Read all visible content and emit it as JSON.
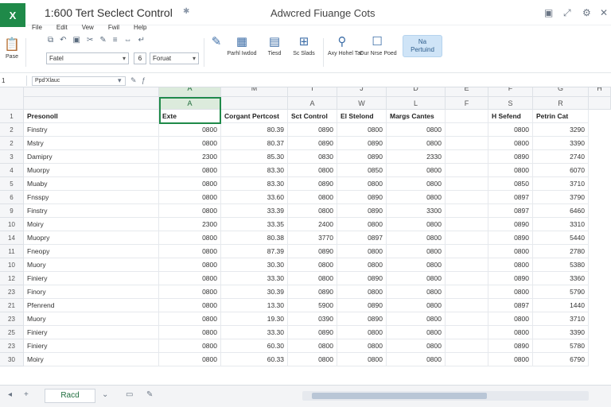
{
  "window": {
    "app_icon": "X",
    "doc_title": "1:600 Tert Seclect Control",
    "app_title": "Adwcred Fiuange Cots"
  },
  "menu": [
    "File",
    "Edit",
    "Vew",
    "Fwil",
    "Help"
  ],
  "ribbon": {
    "paste_label": "Pase",
    "font_value": "Fatel",
    "font_size": "6",
    "number_format": "Foruat",
    "buttons": [
      {
        "icon": "pen-icon",
        "label": ""
      },
      {
        "icon": "table-icon",
        "label": "Parhl Iwdod"
      },
      {
        "icon": "chart-icon",
        "label": "Tiesd"
      },
      {
        "icon": "grid-icon",
        "label": "Sc Slads"
      },
      {
        "icon": "filter-icon",
        "label": "Axy Hohel Tar"
      },
      {
        "icon": "box-icon",
        "label": "Our Nrse Poed"
      }
    ],
    "highlight_label_1": "Na",
    "highlight_label_2": "Pertuind"
  },
  "formula": {
    "name_box": "1",
    "content": "Ppd'Xlauc"
  },
  "columns": {
    "letters": [
      "A",
      "M",
      "T",
      "J",
      "D",
      "E",
      "F",
      "G",
      "H"
    ],
    "second_row": [
      "A",
      "",
      "A",
      "W",
      "L",
      "F",
      "S",
      "R",
      ""
    ]
  },
  "headers": [
    "Presonoll",
    "Exte",
    "Corgant Pertcost",
    "Sct Control",
    "El Stelond",
    "Margs Cantes",
    "",
    "H Sefend",
    "Petrin Cat"
  ],
  "rows": [
    {
      "n": "2",
      "name": "Finstry",
      "c": [
        "0800",
        "80.39",
        "0890",
        "0800",
        "0800",
        "",
        "0800",
        "3290"
      ]
    },
    {
      "n": "2",
      "name": "Mstry",
      "c": [
        "0800",
        "80.37",
        "0890",
        "0890",
        "0800",
        "",
        "0800",
        "3390"
      ]
    },
    {
      "n": "3",
      "name": "Damipry",
      "c": [
        "2300",
        "85.30",
        "0830",
        "0890",
        "2330",
        "",
        "0890",
        "2740"
      ]
    },
    {
      "n": "4",
      "name": "Muorpy",
      "c": [
        "0800",
        "83.30",
        "0800",
        "0850",
        "0800",
        "",
        "0800",
        "6070"
      ]
    },
    {
      "n": "5",
      "name": "Muaby",
      "c": [
        "0800",
        "83.30",
        "0890",
        "0800",
        "0800",
        "",
        "0850",
        "3710"
      ]
    },
    {
      "n": "6",
      "name": "Fnsspy",
      "c": [
        "0800",
        "33.60",
        "0800",
        "0890",
        "0800",
        "",
        "0897",
        "3790"
      ]
    },
    {
      "n": "9",
      "name": "Finstry",
      "c": [
        "0800",
        "33.39",
        "0800",
        "0890",
        "3300",
        "",
        "0897",
        "6460"
      ]
    },
    {
      "n": "10",
      "name": "Moiry",
      "c": [
        "2300",
        "33.35",
        "2400",
        "0800",
        "0800",
        "",
        "0890",
        "3310"
      ]
    },
    {
      "n": "14",
      "name": "Muopry",
      "c": [
        "0800",
        "80.38",
        "3770",
        "0897",
        "0800",
        "",
        "0890",
        "5440"
      ]
    },
    {
      "n": "11",
      "name": "Fneopy",
      "c": [
        "0800",
        "87.39",
        "0890",
        "0800",
        "0800",
        "",
        "0800",
        "2780"
      ]
    },
    {
      "n": "10",
      "name": "Muory",
      "c": [
        "0800",
        "30.30",
        "0800",
        "0800",
        "0800",
        "",
        "0800",
        "5380"
      ]
    },
    {
      "n": "12",
      "name": "Finiery",
      "c": [
        "0800",
        "33.30",
        "0800",
        "0890",
        "0800",
        "",
        "0890",
        "3360"
      ]
    },
    {
      "n": "23",
      "name": "Finory",
      "c": [
        "0800",
        "30.39",
        "0890",
        "0800",
        "0800",
        "",
        "0800",
        "5790"
      ]
    },
    {
      "n": "21",
      "name": "Pfenrend",
      "c": [
        "0800",
        "13.30",
        "5900",
        "0890",
        "0800",
        "",
        "0897",
        "1440"
      ]
    },
    {
      "n": "23",
      "name": "Muory",
      "c": [
        "0800",
        "19.30",
        "0390",
        "0890",
        "0800",
        "",
        "0800",
        "3710"
      ]
    },
    {
      "n": "25",
      "name": "Finiery",
      "c": [
        "0800",
        "33.30",
        "0890",
        "0800",
        "0800",
        "",
        "0800",
        "3390"
      ]
    },
    {
      "n": "23",
      "name": "Finiery",
      "c": [
        "0800",
        "60.30",
        "0800",
        "0800",
        "0800",
        "",
        "0890",
        "5780"
      ]
    },
    {
      "n": "30",
      "name": "Moiry",
      "c": [
        "0800",
        "60.33",
        "0800",
        "0800",
        "0800",
        "",
        "0800",
        "6790"
      ]
    }
  ],
  "status": {
    "sheet_tab": "Racd"
  }
}
